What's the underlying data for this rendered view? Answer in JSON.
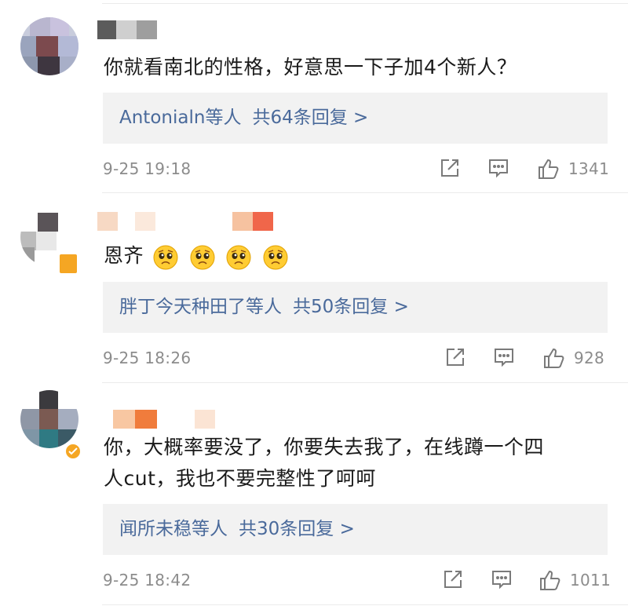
{
  "comments": [
    {
      "text": "你就看南北的性格，好意思一下子加4个新人？",
      "reply_users": "Antonialn",
      "reply_suffix": "等人",
      "reply_count": "共64条回复 >",
      "timestamp": "9-25 19:18",
      "likes": "1341"
    },
    {
      "text": "恩齐",
      "emoji_names": [
        "pleading-face-icon",
        "pleading-face-icon",
        "pleading-face-icon",
        "pleading-face-icon"
      ],
      "reply_users": "胖丁今天种田了",
      "reply_suffix": "等人",
      "reply_count": "共50条回复 >",
      "timestamp": "9-25 18:26",
      "likes": "928"
    },
    {
      "text_line1": "你，大概率要没了，你要失去我了，在线蹲一个四",
      "text_line2": "人cut，我也不要完整性了呵呵",
      "reply_users": "闻所未稳",
      "reply_suffix": "等人",
      "reply_count": "共30条回复 >",
      "timestamp": "9-25 18:42",
      "likes": "1011",
      "verified": true
    }
  ],
  "icons": {
    "share": "share-icon",
    "comment": "comment-icon",
    "like": "thumbs-up-icon",
    "verified": "verified-badge-icon"
  },
  "colors": {
    "reply_link": "#4a6a9b",
    "meta_text": "#8c8c8c",
    "reply_bg": "#f2f2f2",
    "badge": "#f5a623"
  }
}
